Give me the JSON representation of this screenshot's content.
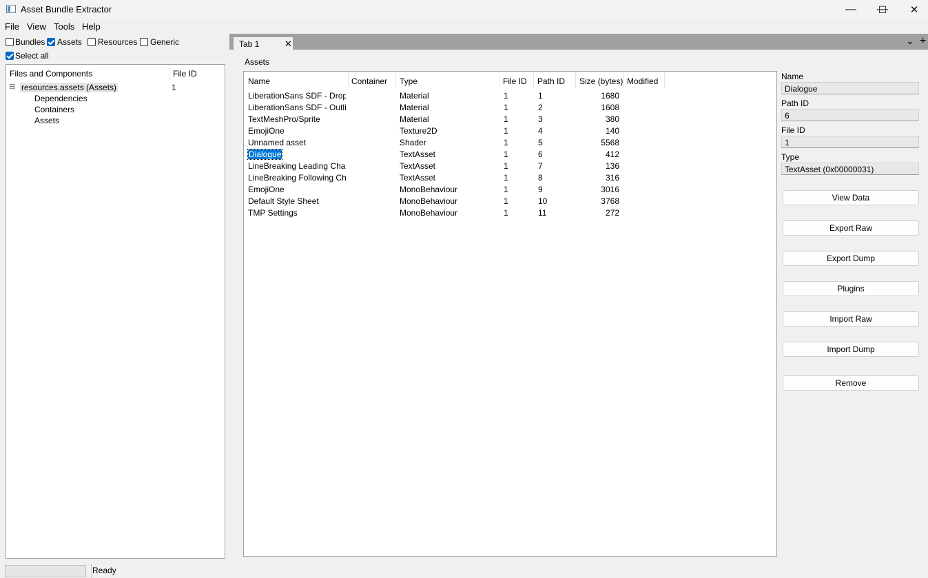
{
  "window": {
    "title": "Asset Bundle Extractor",
    "controls": [
      "—",
      "☐",
      "✕"
    ]
  },
  "menu": [
    "File",
    "View",
    "Tools",
    "Help"
  ],
  "filters": {
    "items": [
      {
        "label": "Bundles",
        "checked": false
      },
      {
        "label": "Assets",
        "checked": true
      },
      {
        "label": "Resources",
        "checked": false
      },
      {
        "label": "Generic",
        "checked": false
      }
    ],
    "select_all": {
      "label": "Select all",
      "checked": true
    }
  },
  "tree": {
    "headers": [
      "Files and Components",
      "File ID"
    ],
    "root": {
      "expander": "⊟",
      "label": "resources.assets (Assets)",
      "file_id": "1"
    },
    "children": [
      "Dependencies",
      "Containers",
      "Assets"
    ]
  },
  "tabs": {
    "items": [
      {
        "label": "Tab 1",
        "close": "✕"
      }
    ],
    "dropdown_icon": "⌄",
    "add_icon": "+"
  },
  "assets": {
    "section_label": "Assets",
    "columns": [
      "Name",
      "Container",
      "Type",
      "File ID",
      "Path ID",
      "Size (bytes)",
      "Modified"
    ],
    "selected_index": 5,
    "rows": [
      {
        "name": "LiberationSans SDF - Drop ...",
        "container": "",
        "type": "Material",
        "file_id": "1",
        "path_id": "1",
        "size": "1680",
        "modified": ""
      },
      {
        "name": "LiberationSans SDF - Outline",
        "container": "",
        "type": "Material",
        "file_id": "1",
        "path_id": "2",
        "size": "1608",
        "modified": ""
      },
      {
        "name": "TextMeshPro/Sprite",
        "container": "",
        "type": "Material",
        "file_id": "1",
        "path_id": "3",
        "size": "380",
        "modified": ""
      },
      {
        "name": "EmojiOne",
        "container": "",
        "type": "Texture2D",
        "file_id": "1",
        "path_id": "4",
        "size": "140",
        "modified": ""
      },
      {
        "name": "Unnamed asset",
        "container": "",
        "type": "Shader",
        "file_id": "1",
        "path_id": "5",
        "size": "5568",
        "modified": ""
      },
      {
        "name": "Dialogue",
        "container": "",
        "type": "TextAsset",
        "file_id": "1",
        "path_id": "6",
        "size": "412",
        "modified": ""
      },
      {
        "name": "LineBreaking Leading Char...",
        "container": "",
        "type": "TextAsset",
        "file_id": "1",
        "path_id": "7",
        "size": "136",
        "modified": ""
      },
      {
        "name": "LineBreaking Following Cha...",
        "container": "",
        "type": "TextAsset",
        "file_id": "1",
        "path_id": "8",
        "size": "316",
        "modified": ""
      },
      {
        "name": "EmojiOne",
        "container": "",
        "type": "MonoBehaviour",
        "file_id": "1",
        "path_id": "9",
        "size": "3016",
        "modified": ""
      },
      {
        "name": "Default Style Sheet",
        "container": "",
        "type": "MonoBehaviour",
        "file_id": "1",
        "path_id": "10",
        "size": "3768",
        "modified": ""
      },
      {
        "name": "TMP Settings",
        "container": "",
        "type": "MonoBehaviour",
        "file_id": "1",
        "path_id": "11",
        "size": "272",
        "modified": ""
      }
    ]
  },
  "details": {
    "name_label": "Name",
    "name_value": "Dialogue",
    "path_id_label": "Path ID",
    "path_id_value": "6",
    "file_id_label": "File ID",
    "file_id_value": "1",
    "type_label": "Type",
    "type_value": "TextAsset (0x00000031)"
  },
  "actions": {
    "view_data": "View Data",
    "export_raw": "Export Raw",
    "export_dump": "Export Dump",
    "plugins": "Plugins",
    "import_raw": "Import Raw",
    "import_dump": "Import Dump",
    "remove": "Remove"
  },
  "status": {
    "text": "Ready"
  }
}
